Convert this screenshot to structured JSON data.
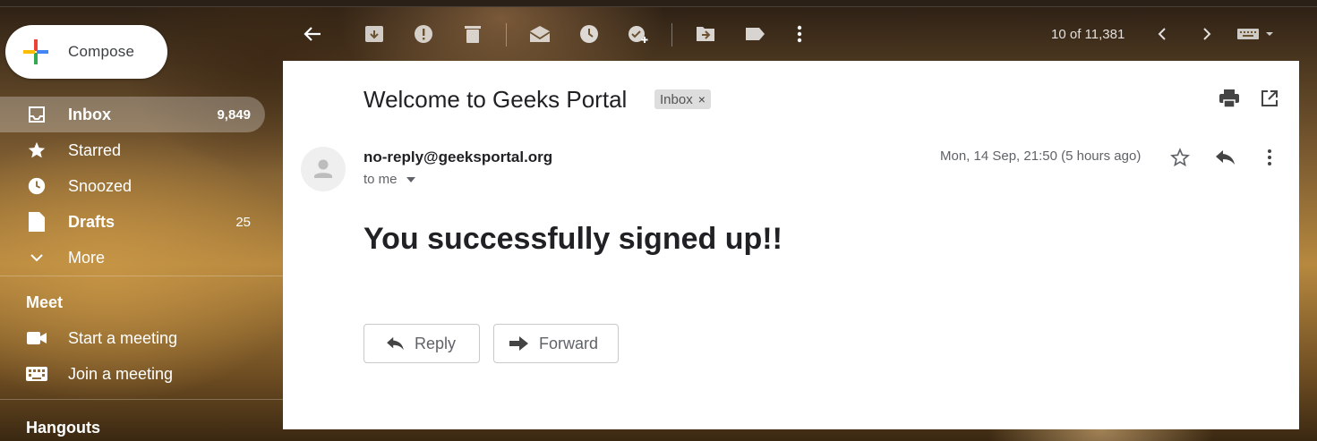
{
  "compose": {
    "label": "Compose",
    "colors": [
      "#ea4335",
      "#4285f4",
      "#34a853",
      "#fbbc04"
    ]
  },
  "sidebar": {
    "items": [
      {
        "icon": "inbox-icon",
        "label": "Inbox",
        "count": "9,849"
      },
      {
        "icon": "star-icon",
        "label": "Starred",
        "count": ""
      },
      {
        "icon": "clock-icon",
        "label": "Snoozed",
        "count": ""
      },
      {
        "icon": "draft-icon",
        "label": "Drafts",
        "count": "25"
      },
      {
        "icon": "chevron-down-icon",
        "label": "More",
        "count": ""
      }
    ],
    "meet": {
      "title": "Meet",
      "items": [
        {
          "icon": "video-camera-icon",
          "label": "Start a meeting"
        },
        {
          "icon": "keyboard-icon",
          "label": "Join a meeting"
        }
      ]
    },
    "hangouts": {
      "title": "Hangouts"
    }
  },
  "toolbar": {
    "icons": [
      "back-arrow-icon",
      "archive-icon",
      "report-spam-icon",
      "delete-icon",
      "mark-unread-icon",
      "snooze-icon",
      "add-task-icon",
      "move-to-icon",
      "label-icon",
      "more-vert-icon"
    ],
    "pager": "10 of 11,381",
    "nav_icons": [
      "chevron-left-icon",
      "chevron-right-icon",
      "keyboard-icon"
    ]
  },
  "message": {
    "subject": "Welcome to Geeks Portal",
    "label": "Inbox",
    "label_close": "×",
    "sender": "no-reply@geeksportal.org",
    "to": "to me",
    "date": "Mon, 14 Sep, 21:50 (5 hours ago)",
    "body": "You successfully signed up!!",
    "reply_label": "Reply",
    "forward_label": "Forward"
  }
}
